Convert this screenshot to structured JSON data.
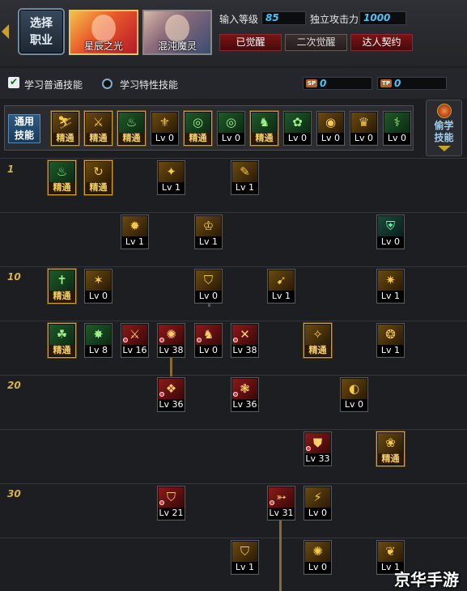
{
  "header": {
    "choose_class": "选择\n职业",
    "portraits": [
      {
        "name": "星辰之光",
        "selected": true
      },
      {
        "name": "混沌魔灵",
        "selected": false
      }
    ],
    "level_label": "输入等级",
    "level_value": "85",
    "attack_label": "独立攻击力",
    "attack_value": "1000",
    "awakening_tabs": [
      "已觉醒",
      "二次觉醒",
      "达人契约"
    ]
  },
  "learn_bar": {
    "normal_label": "学习普通技能",
    "normal_checked": true,
    "special_label": "学习特性技能",
    "special_checked": false,
    "sp_points": "0",
    "tp_points": "0"
  },
  "general": {
    "label": "通用\n技能",
    "steal_label": "偷学\n技能",
    "skills": [
      {
        "icon": "⛷",
        "cap": "精通",
        "gold": true,
        "color": "gold"
      },
      {
        "icon": "⚔",
        "cap": "精通",
        "gold": true,
        "color": "gold"
      },
      {
        "icon": "♨",
        "cap": "精通",
        "gold": true,
        "color": "green"
      },
      {
        "icon": "⚜",
        "cap": "Lv 0",
        "gold": false,
        "color": "gold"
      },
      {
        "icon": "◎",
        "cap": "精通",
        "gold": true,
        "color": "green"
      },
      {
        "icon": "◎",
        "cap": "Lv 0",
        "gold": false,
        "color": "green"
      },
      {
        "icon": "♞",
        "cap": "精通",
        "gold": true,
        "color": "green"
      },
      {
        "icon": "✿",
        "cap": "Lv 0",
        "gold": false,
        "color": "green"
      },
      {
        "icon": "◉",
        "cap": "Lv 0",
        "gold": false,
        "color": "gold"
      },
      {
        "icon": "♛",
        "cap": "Lv 0",
        "gold": false,
        "color": "gold"
      },
      {
        "icon": "⚕",
        "cap": "Lv 0",
        "gold": false,
        "color": "green"
      }
    ]
  },
  "level_markers": [
    "1",
    "10",
    "20",
    "30"
  ],
  "tree": [
    {
      "icon": "♨",
      "cap": "精通",
      "gold": true,
      "color": "green"
    },
    {
      "icon": "↻",
      "cap": "精通",
      "gold": true,
      "color": "gold"
    },
    {
      "icon": "✦",
      "cap": "Lv 1",
      "gold": false,
      "color": "gold"
    },
    {
      "icon": "✎",
      "cap": "Lv 1",
      "gold": false,
      "color": "gold"
    },
    {
      "icon": "✹",
      "cap": "Lv 1",
      "gold": false,
      "color": "gold"
    },
    {
      "icon": "♔",
      "cap": "Lv 1",
      "gold": false,
      "color": "gold"
    },
    {
      "icon": "⛨",
      "cap": "Lv 0",
      "gold": false,
      "color": "teal"
    },
    {
      "icon": "✝",
      "cap": "精通",
      "gold": true,
      "color": "green"
    },
    {
      "icon": "✶",
      "cap": "Lv 0",
      "gold": false,
      "color": "gold"
    },
    {
      "icon": "⛉",
      "cap": "Lv 0",
      "gold": false,
      "color": "gold"
    },
    {
      "icon": "➹",
      "cap": "Lv 1",
      "gold": false,
      "color": "gold"
    },
    {
      "icon": "✷",
      "cap": "Lv 1",
      "gold": false,
      "color": "gold"
    },
    {
      "icon": "☘",
      "cap": "精通",
      "gold": true,
      "color": "green"
    },
    {
      "icon": "✸",
      "cap": "Lv 8",
      "gold": false,
      "color": "green"
    },
    {
      "icon": "⚔",
      "cap": "Lv 16",
      "gold": false,
      "color": "red"
    },
    {
      "icon": "✺",
      "cap": "Lv 38",
      "gold": false,
      "color": "red"
    },
    {
      "icon": "♞",
      "cap": "Lv 0",
      "gold": false,
      "color": "red"
    },
    {
      "icon": "✕",
      "cap": "Lv 38",
      "gold": false,
      "color": "red"
    },
    {
      "icon": "✧",
      "cap": "精通",
      "gold": true,
      "color": "gold"
    },
    {
      "icon": "❂",
      "cap": "Lv 1",
      "gold": false,
      "color": "gold"
    },
    {
      "icon": "❖",
      "cap": "Lv 36",
      "gold": false,
      "color": "red"
    },
    {
      "icon": "❃",
      "cap": "Lv 36",
      "gold": false,
      "color": "red"
    },
    {
      "icon": "◐",
      "cap": "Lv 0",
      "gold": false,
      "color": "gold"
    },
    {
      "icon": "⛊",
      "cap": "Lv 33",
      "gold": false,
      "color": "red"
    },
    {
      "icon": "❀",
      "cap": "精通",
      "gold": true,
      "color": "gold"
    },
    {
      "icon": "⛉",
      "cap": "Lv 21",
      "gold": false,
      "color": "red"
    },
    {
      "icon": "➳",
      "cap": "Lv 31",
      "gold": false,
      "color": "red"
    },
    {
      "icon": "⚡",
      "cap": "Lv 0",
      "gold": false,
      "color": "gold"
    },
    {
      "icon": "⛉",
      "cap": "Lv 1",
      "gold": false,
      "color": "gold"
    },
    {
      "icon": "✺",
      "cap": "Lv 0",
      "gold": false,
      "color": "gold"
    },
    {
      "icon": "❦",
      "cap": "Lv 1",
      "gold": false,
      "color": "gold"
    }
  ],
  "watermark": "京华手游"
}
